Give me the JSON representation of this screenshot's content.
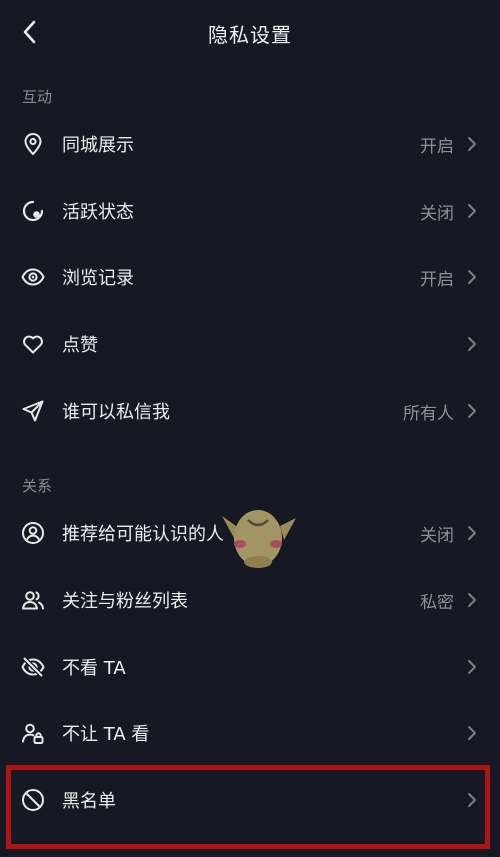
{
  "header": {
    "title": "隐私设置",
    "back_icon": "chevron-left-icon"
  },
  "sections": [
    {
      "label": "互动"
    },
    {
      "label": "关系"
    }
  ],
  "items": [
    {
      "label": "同城展示",
      "value": "开启",
      "icon": "location-pin-icon"
    },
    {
      "label": "活跃状态",
      "value": "关闭",
      "icon": "activity-status-icon"
    },
    {
      "label": "浏览记录",
      "value": "开启",
      "icon": "eye-icon"
    },
    {
      "label": "点赞",
      "value": "",
      "icon": "heart-icon"
    },
    {
      "label": "谁可以私信我",
      "value": "所有人",
      "icon": "send-icon"
    },
    {
      "label": "推荐给可能认识的人",
      "value": "关闭",
      "icon": "user-circle-icon"
    },
    {
      "label": "关注与粉丝列表",
      "value": "私密",
      "icon": "users-icon"
    },
    {
      "label": "不看 TA",
      "value": "",
      "icon": "eye-off-icon"
    },
    {
      "label": "不让 TA 看",
      "value": "",
      "icon": "user-lock-icon"
    },
    {
      "label": "黑名单",
      "value": "",
      "icon": "block-icon"
    }
  ],
  "colors": {
    "background": "#161823",
    "highlight": "#b01313"
  }
}
